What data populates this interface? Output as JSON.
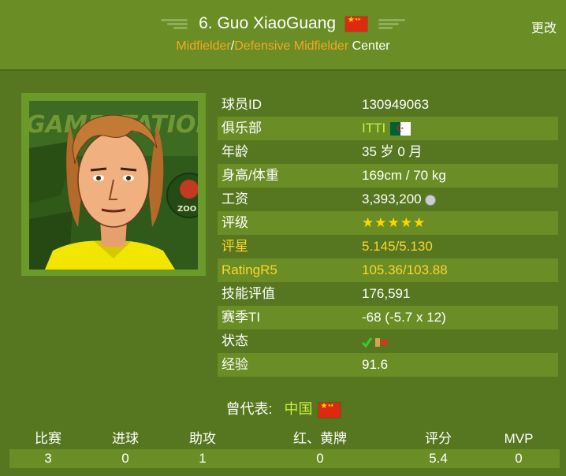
{
  "header": {
    "number_name": "6. Guo XiaoGuang",
    "nation_flag": "china-flag-icon",
    "edit_label": "更改",
    "position_primary": "Midfielder",
    "position_separator": "/",
    "position_secondary": "Defensive Midfielder",
    "position_side": "Center"
  },
  "portrait": {
    "banner_text": "GAMESTATION",
    "sponsor_text": "ZOO"
  },
  "info": {
    "rows": [
      {
        "key": "球员ID",
        "value": "130949063"
      },
      {
        "key": "俱乐部",
        "value": "ITTI"
      },
      {
        "key": "年龄",
        "value": "35 岁 0 月"
      },
      {
        "key": "身高/体重",
        "value": "169cm / 70 kg"
      },
      {
        "key": "工资",
        "value": "3,393,200"
      },
      {
        "key": "评级",
        "value": "★★★★★"
      },
      {
        "key": "评星",
        "value": "5.145/5.130"
      },
      {
        "key": "RatingR5",
        "value": "105.36/103.88"
      },
      {
        "key": "技能评值",
        "value": "176,591"
      },
      {
        "key": "赛季TI",
        "value": "-68 (-5.7 x 12)"
      },
      {
        "key": "状态",
        "value": ""
      },
      {
        "key": "经验",
        "value": "91.6"
      }
    ],
    "rating_stars": 5
  },
  "represented": {
    "label": "曾代表:",
    "country": "中国"
  },
  "stats": {
    "headers": [
      "比赛",
      "进球",
      "助攻",
      "红、黄牌",
      "评分",
      "MVP"
    ],
    "values": [
      "3",
      "0",
      "1",
      "0",
      "5.4",
      "0"
    ]
  },
  "colors": {
    "background": "#56771f",
    "row_alt": "#6a8e25",
    "accent_orange": "#f5a623",
    "accent_gold": "#ffd42a",
    "club_link": "#c8f03c"
  }
}
